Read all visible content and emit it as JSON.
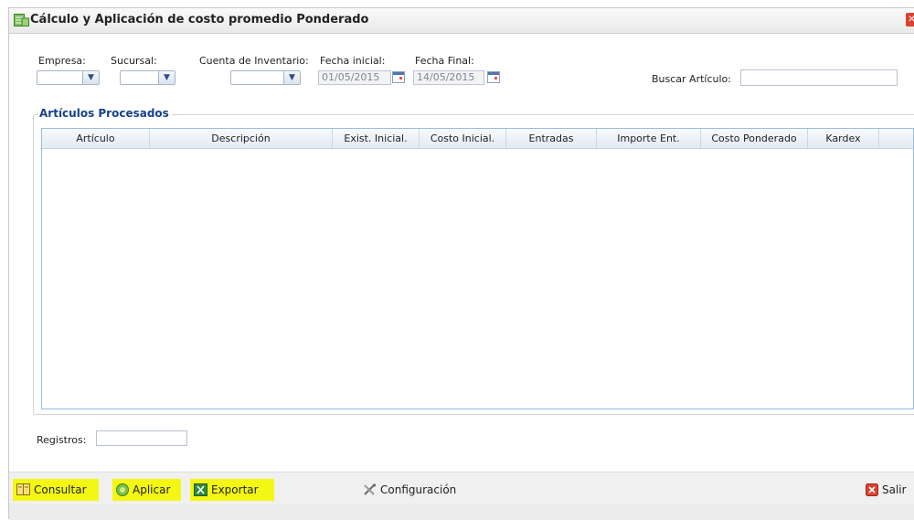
{
  "window": {
    "title": "Cálculo y Aplicación de costo promedio Ponderado"
  },
  "filters": {
    "empresa_label": "Empresa:",
    "sucursal_label": "Sucursal:",
    "cuenta_label": "Cuenta de Inventario:",
    "fecha_inicial_label": "Fecha inicial:",
    "fecha_inicial_value": "01/05/2015",
    "fecha_final_label": "Fecha Final:",
    "fecha_final_value": "14/05/2015",
    "buscar_label": "Buscar Artículo:"
  },
  "grid": {
    "legend": "Artículos Procesados",
    "columns": [
      "Artículo",
      "Descripción",
      "Exist. Inicial.",
      "Costo Inicial.",
      "Entradas",
      "Importe Ent.",
      "Costo Ponderado",
      "Kardex"
    ],
    "rows": []
  },
  "footer": {
    "registros_label": "Registros:"
  },
  "toolbar": {
    "consultar": "Consultar",
    "aplicar": "Aplicar",
    "exportar": "Exportar",
    "configuracion": "Configuración",
    "salir": "Salir"
  },
  "colors": {
    "highlight": "#f4f714",
    "accent": "#15428b"
  }
}
